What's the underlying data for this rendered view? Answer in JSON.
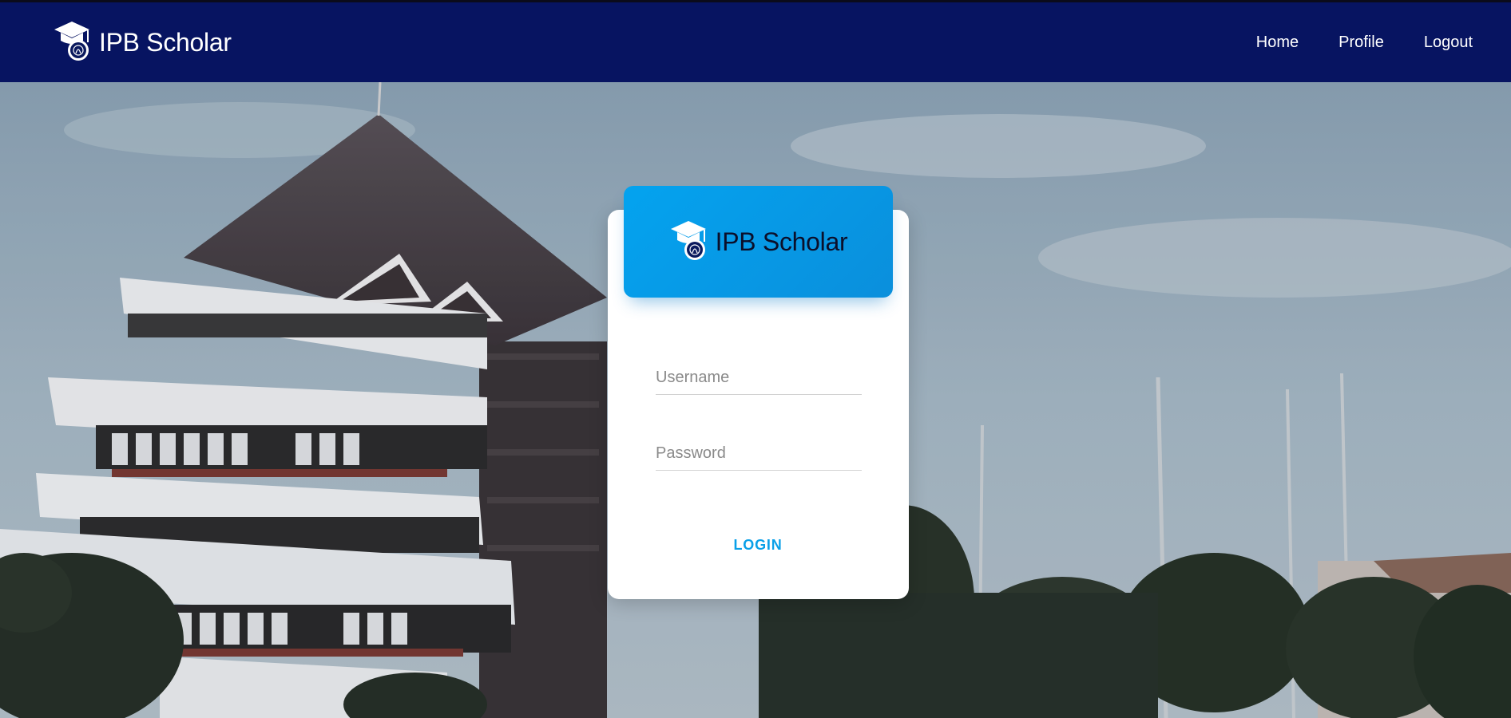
{
  "navbar": {
    "brand_text": "IPB Scholar",
    "brand_icon": "graduation-cap-seal-icon",
    "links": [
      {
        "label": "Home"
      },
      {
        "label": "Profile"
      },
      {
        "label": "Logout"
      }
    ],
    "background_color": "#071461"
  },
  "login_card": {
    "header_brand_text": "IPB Scholar",
    "header_icon": "graduation-cap-seal-icon",
    "header_color": "#04a3ef",
    "username_placeholder": "Username",
    "password_placeholder": "Password",
    "login_label": "LOGIN",
    "accent_color": "#0aa0e8"
  }
}
